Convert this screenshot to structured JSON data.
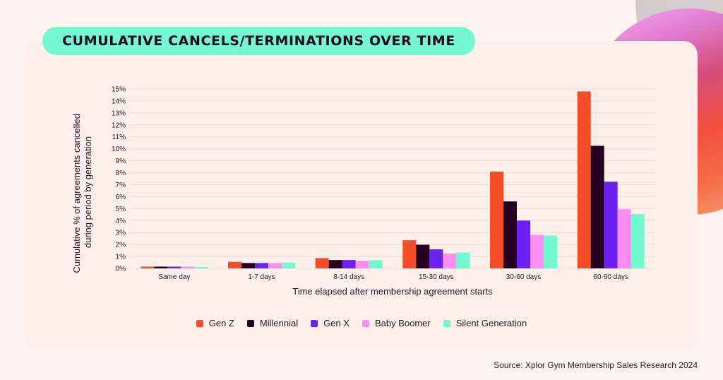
{
  "title": "CUMULATIVE CANCELS/TERMINATIONS OVER TIME",
  "source": "Source: Xplor Gym Membership Sales Research 2024",
  "colors": {
    "gen_z": "#f54e26",
    "millennial": "#250020",
    "gen_x": "#6c22f5",
    "baby_boomer": "#ff8cf0",
    "silent_generation": "#72f8cf",
    "title_pill": "#74f8cf",
    "gridline": "#eadcd6"
  },
  "chart_data": {
    "type": "bar",
    "title": "CUMULATIVE CANCELS/TERMINATIONS OVER TIME",
    "xlabel": "Time elapsed after membership agreement starts",
    "ylabel": "Cumulative % of agreements cancelled during period by generation",
    "ylabel_lines": [
      "Cumulative % of agreements cancelled",
      "during period by generation"
    ],
    "ylim": [
      0,
      15
    ],
    "yticks": [
      0,
      1,
      2,
      3,
      4,
      5,
      6,
      7,
      8,
      9,
      10,
      11,
      12,
      13,
      14,
      15
    ],
    "ytick_labels": [
      "0%",
      "1%",
      "2%",
      "3%",
      "4%",
      "5%",
      "6%",
      "7%",
      "8%",
      "9%",
      "10%",
      "11%",
      "12%",
      "13%",
      "14%",
      "15%"
    ],
    "grid": true,
    "legend_position": "bottom",
    "categories": [
      "Same day",
      "1-7 days",
      "8-14 days",
      "15-30 days",
      "30-60 days",
      "60-90 days"
    ],
    "series": [
      {
        "name": "Gen Z",
        "color": "#f54e26",
        "values": [
          0.15,
          0.55,
          0.86,
          2.35,
          8.1,
          14.8
        ]
      },
      {
        "name": "Millennial",
        "color": "#250020",
        "values": [
          0.15,
          0.45,
          0.7,
          1.98,
          5.6,
          10.25
        ]
      },
      {
        "name": "Gen X",
        "color": "#6c22f5",
        "values": [
          0.15,
          0.45,
          0.7,
          1.6,
          4.0,
          7.25
        ]
      },
      {
        "name": "Baby Boomer",
        "color": "#ff8cf0",
        "values": [
          0.15,
          0.45,
          0.63,
          1.25,
          2.8,
          4.95
        ]
      },
      {
        "name": "Silent Generation",
        "color": "#72f8cf",
        "values": [
          0.12,
          0.48,
          0.7,
          1.33,
          2.75,
          4.55
        ]
      }
    ]
  }
}
